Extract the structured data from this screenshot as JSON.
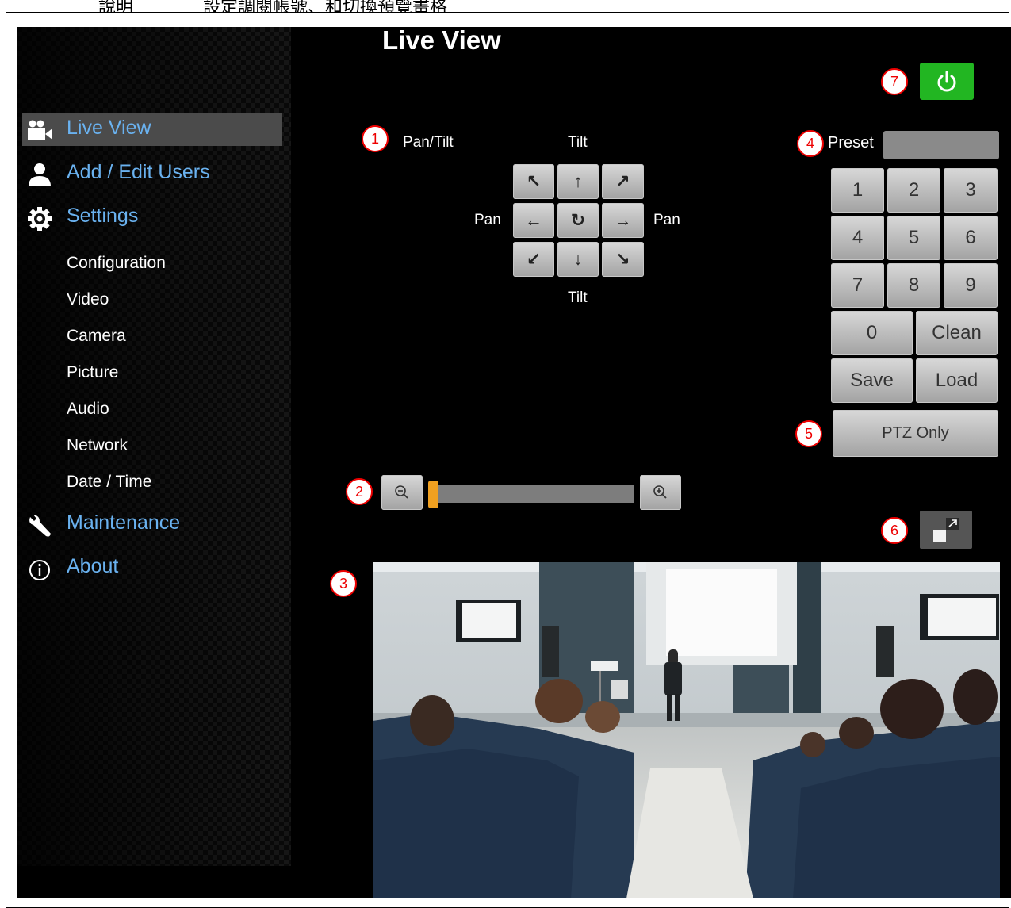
{
  "doc_header": {
    "part_a": "說明",
    "part_b": "設定調閱帳號、和切換預覽畫格"
  },
  "page": {
    "title": "Live View"
  },
  "sidebar": {
    "main_items": [
      {
        "label": "Live View",
        "icon": "video-camera-icon"
      },
      {
        "label": "Add / Edit Users",
        "icon": "user-icon"
      },
      {
        "label": "Settings",
        "icon": "gear-icon"
      },
      {
        "label": "Maintenance",
        "icon": "wrench-icon"
      },
      {
        "label": "About",
        "icon": "info-icon"
      }
    ],
    "sub_items": [
      "Configuration",
      "Video",
      "Camera",
      "Picture",
      "Audio",
      "Network",
      "Date / Time"
    ]
  },
  "pan_tilt": {
    "label": "Pan/Tilt",
    "tilt_top": "Tilt",
    "tilt_bottom": "Tilt",
    "pan_left": "Pan",
    "pan_right": "Pan",
    "buttons": [
      "↖",
      "↑",
      "↗",
      "←",
      "↻",
      "→",
      "↙",
      "↓",
      "↘"
    ]
  },
  "preset": {
    "label": "Preset",
    "value": "",
    "keys": [
      "1",
      "2",
      "3",
      "4",
      "5",
      "6",
      "7",
      "8",
      "9"
    ],
    "zero": "0",
    "clean": "Clean",
    "save": "Save",
    "load": "Load",
    "ptz_only": "PTZ Only"
  },
  "zoom": {
    "level": 0.0
  },
  "markers": [
    "1",
    "2",
    "3",
    "4",
    "5",
    "6",
    "7"
  ],
  "colors": {
    "link": "#6ab2f0",
    "power": "#22b622",
    "zoom_thumb": "#f0a020",
    "marker": "#ee0000"
  }
}
